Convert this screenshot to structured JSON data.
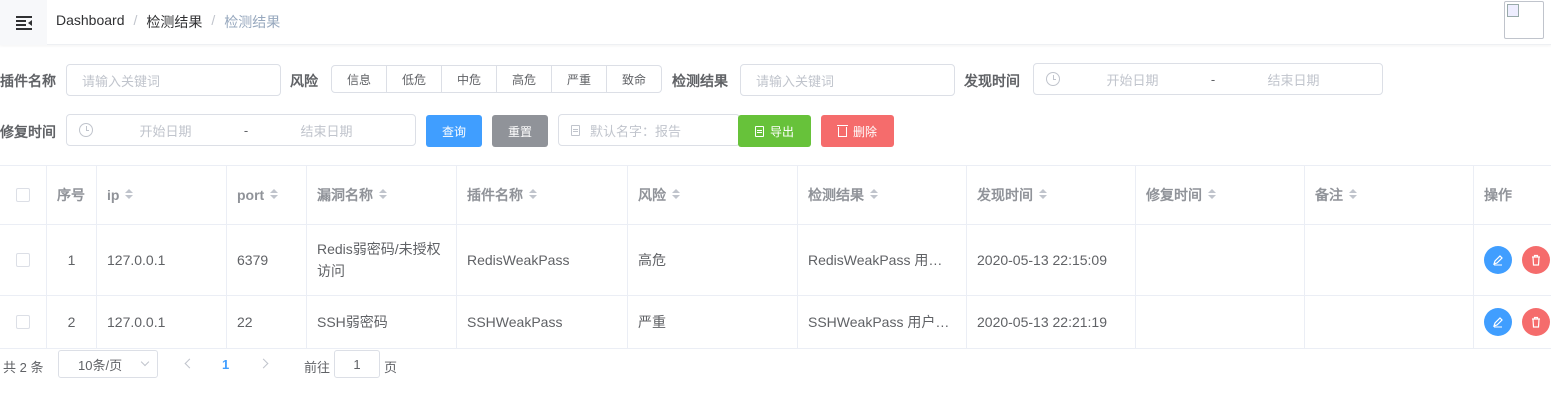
{
  "header": {
    "breadcrumb": [
      "Dashboard",
      "检测结果",
      "检测结果"
    ]
  },
  "filters": {
    "plugin_label": "插件名称",
    "plugin_placeholder": "请输入关键词",
    "risk_label": "风险",
    "risk_options": [
      "信息",
      "低危",
      "中危",
      "高危",
      "严重",
      "致命"
    ],
    "result_label": "检测结果",
    "result_placeholder": "请输入关键词",
    "found_time_label": "发现时间",
    "repair_time_label": "修复时间",
    "start_date": "开始日期",
    "range_sep": "-",
    "end_date": "结束日期",
    "query_button": "查询",
    "reset_button": "重置",
    "export_name_placeholder": "默认名字：报告",
    "export_button": "导出",
    "delete_button": "删除"
  },
  "table": {
    "columns": [
      "序号",
      "ip",
      "port",
      "漏洞名称",
      "插件名称",
      "风险",
      "检测结果",
      "发现时间",
      "修复时间",
      "备注",
      "操作"
    ],
    "rows": [
      {
        "index": "1",
        "ip": "127.0.0.1",
        "port": "6379",
        "vuln": "Redis弱密码/未授权访问",
        "plugin": "RedisWeakPass",
        "risk": "高危",
        "result": "RedisWeakPass 用户名：",
        "found": "2020-05-13 22:15:09",
        "repair": "",
        "note": ""
      },
      {
        "index": "2",
        "ip": "127.0.0.1",
        "port": "22",
        "vuln": "SSH弱密码",
        "plugin": "SSHWeakPass",
        "risk": "严重",
        "result": "SSHWeakPass 用户名：",
        "found": "2020-05-13 22:21:19",
        "repair": "",
        "note": ""
      }
    ]
  },
  "pagination": {
    "total": "共 2 条",
    "page_size": "10条/页",
    "current_page": "1",
    "goto_label": "前往",
    "goto_value": "1",
    "page_suffix": "页"
  }
}
